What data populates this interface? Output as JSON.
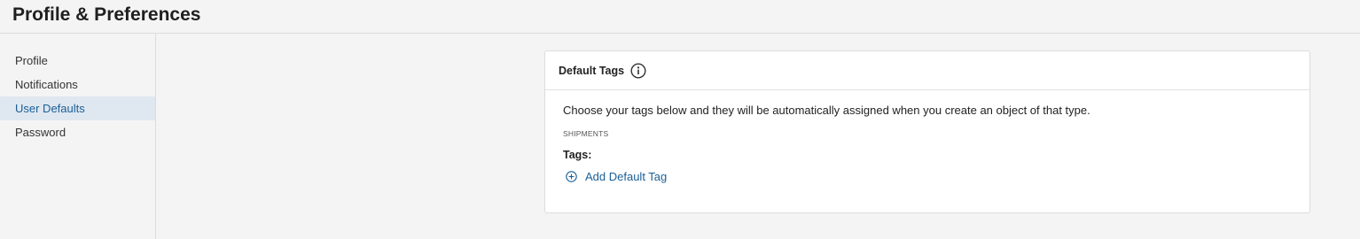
{
  "header": {
    "title": "Profile & Preferences"
  },
  "sidebar": {
    "items": [
      {
        "label": "Profile",
        "active": false
      },
      {
        "label": "Notifications",
        "active": false
      },
      {
        "label": "User Defaults",
        "active": true
      },
      {
        "label": "Password",
        "active": false
      }
    ]
  },
  "card": {
    "title": "Default Tags",
    "info_icon": "info-circle-icon",
    "description": "Choose your tags below and they will be automatically assigned when you create an object of that type.",
    "section_label": "SHIPMENTS",
    "tags_label": "Tags:",
    "add_button_label": "Add Default Tag",
    "add_icon": "plus-circle-icon"
  },
  "colors": {
    "accent": "#1a5f96",
    "active_nav_bg": "#dfe7f0",
    "background": "#f4f4f4"
  }
}
